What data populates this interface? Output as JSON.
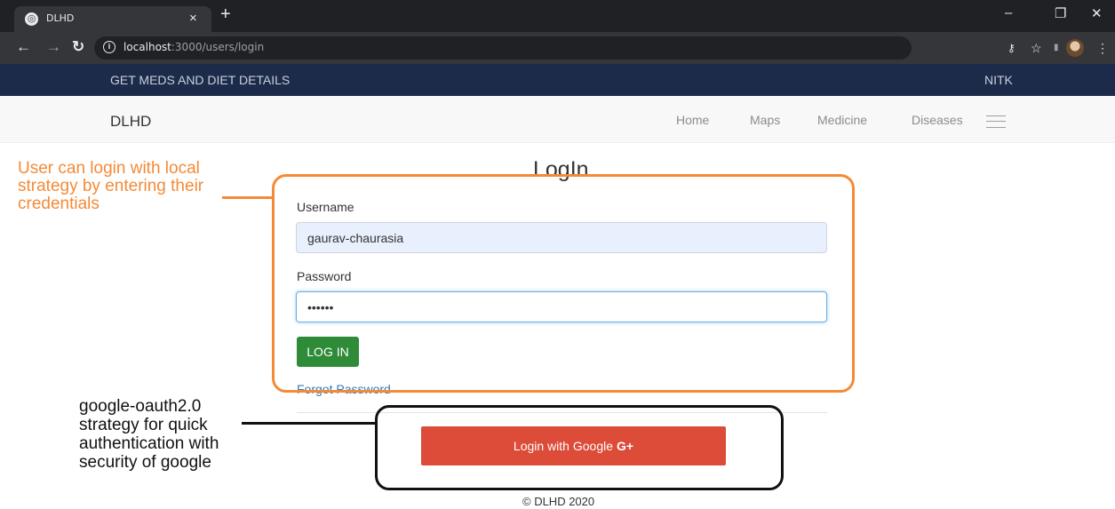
{
  "browser": {
    "tab_title": "DLHD",
    "tab_close": "×",
    "new_tab": "+",
    "url_host": "localhost",
    "url_rest": ":3000/users/login",
    "minimize": "–",
    "restore": "❐",
    "close": "✕"
  },
  "site": {
    "top_strip_left": "GET MEDS AND DIET DETAILS",
    "top_strip_right": "NITK",
    "brand": "DLHD",
    "nav": [
      "Home",
      "Maps",
      "Medicine",
      "Diseases"
    ]
  },
  "login": {
    "title": "LogIn",
    "username_label": "Username",
    "username_value": "gaurav-chaurasia",
    "password_label": "Password",
    "password_value": "••••••",
    "login_button": "LOG IN",
    "forgot_link": "Forgot Password",
    "google_button": "Login with Google",
    "google_plus": "G+",
    "footer": "© DLHD 2020"
  },
  "annotations": {
    "local_strategy": "User can login with local strategy by entering their credentials",
    "google_strategy": "google-oauth2.0 strategy for quick authentication with security of google"
  },
  "colors": {
    "annotation_orange": "#f58a36",
    "login_green": "#2e8b38",
    "google_red": "#dd4b39",
    "top_strip_navy": "#1c2b4a"
  }
}
